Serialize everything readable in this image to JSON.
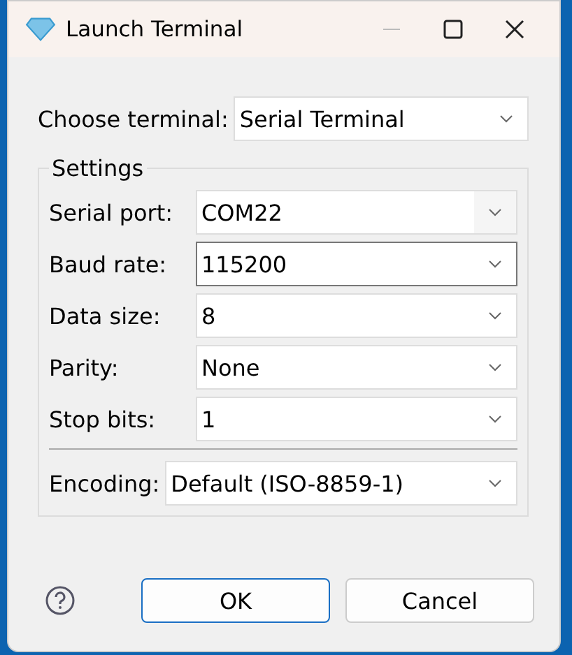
{
  "window": {
    "title": "Launch Terminal"
  },
  "terminal": {
    "label": "Choose terminal:",
    "value": "Serial Terminal"
  },
  "settings": {
    "title": "Settings",
    "fields": [
      {
        "label": "Serial port:",
        "value": "COM22",
        "kind": "editable",
        "focused": false
      },
      {
        "label": "Baud rate:",
        "value": "115200",
        "kind": "dropdown",
        "focused": true
      },
      {
        "label": "Data size:",
        "value": "8",
        "kind": "dropdown",
        "focused": false
      },
      {
        "label": "Parity:",
        "value": "None",
        "kind": "dropdown",
        "focused": false
      },
      {
        "label": "Stop bits:",
        "value": "1",
        "kind": "dropdown",
        "focused": false
      }
    ],
    "encoding": {
      "label": "Encoding:",
      "value": "Default (ISO-8859-1)"
    }
  },
  "buttons": [
    {
      "label": "OK",
      "default": true
    },
    {
      "label": "Cancel",
      "default": false
    }
  ]
}
